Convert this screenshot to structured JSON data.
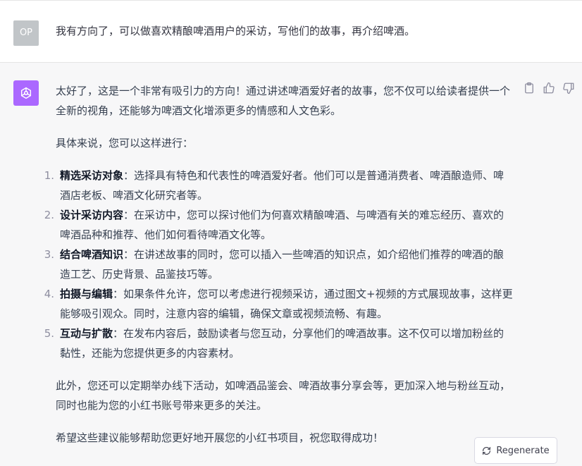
{
  "user": {
    "initials": "OP",
    "message": "我有方向了，可以做喜欢精酿啤酒用户的采访，写他们的故事，再介绍啤酒。"
  },
  "assistant": {
    "intro": "太好了，这是一个非常有吸引力的方向！通过讲述啤酒爱好者的故事，您不仅可以给读者提供一个全新的视角，还能够为啤酒文化增添更多的情感和人文色彩。",
    "lead": "具体来说，您可以这样进行：",
    "items": [
      {
        "num": "1.",
        "title": "精选采访对象",
        "text": "：选择具有特色和代表性的啤酒爱好者。他们可以是普通消费者、啤酒酿造师、啤酒店老板、啤酒文化研究者等。"
      },
      {
        "num": "2.",
        "title": "设计采访内容",
        "text": "：在采访中，您可以探讨他们为何喜欢精酿啤酒、与啤酒有关的难忘经历、喜欢的啤酒品种和推荐、他们如何看待啤酒文化等。"
      },
      {
        "num": "3.",
        "title": "结合啤酒知识",
        "text": "：在讲述故事的同时，您可以插入一些啤酒的知识点，如介绍他们推荐的啤酒的酿造工艺、历史背景、品鉴技巧等。"
      },
      {
        "num": "4.",
        "title": "拍摄与编辑",
        "text": "：如果条件允许，您可以考虑进行视频采访，通过图文+视频的方式展现故事，这样更能够吸引观众。同时，注意内容的编辑，确保文章或视频流畅、有趣。"
      },
      {
        "num": "5.",
        "title": "互动与扩散",
        "text": "：在发布内容后，鼓励读者与您互动，分享他们的啤酒故事。这不仅可以增加粉丝的黏性，还能为您提供更多的内容素材。"
      }
    ],
    "extra": "此外，您还可以定期举办线下活动，如啤酒品鉴会、啤酒故事分享会等，更加深入地与粉丝互动，同时也能为您的小红书账号带来更多的关注。",
    "closing": "希望这些建议能够帮助您更好地开展您的小红书项目，祝您取得成功！"
  },
  "regenerate_label": "Regenerate",
  "icons": {
    "copy": "clipboard-icon",
    "like": "thumbs-up-icon",
    "dislike": "thumbs-down-icon",
    "regen": "refresh-icon",
    "bot": "openai-logo-icon"
  },
  "colors": {
    "bot_avatar": "#ab68ff",
    "user_avatar": "#c1c5c8",
    "assistant_bg": "#f7f7f8"
  }
}
